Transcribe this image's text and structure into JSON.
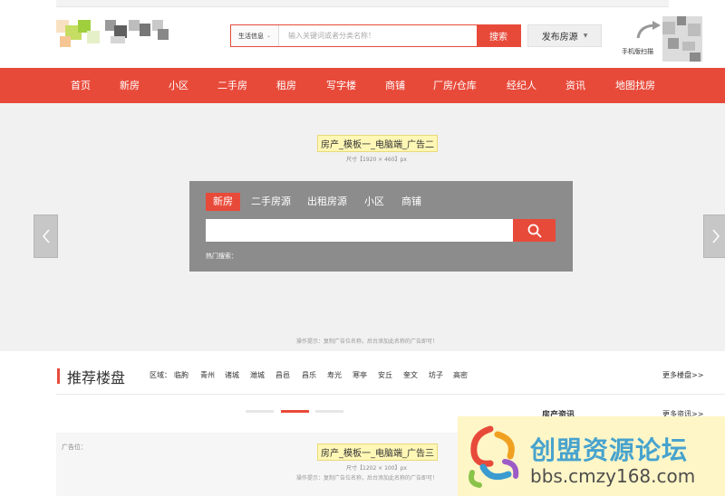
{
  "header": {
    "search": {
      "category": "生活信息",
      "placeholder": "输入关键词或者分类名称！",
      "button": "搜索"
    },
    "publish_button": "发布房源",
    "mobile_text": "手机版扫描"
  },
  "nav": {
    "items": [
      "首页",
      "新房",
      "小区",
      "二手房",
      "租房",
      "写字楼",
      "商铺",
      "厂房/仓库",
      "经纪人",
      "资讯",
      "地图找房"
    ]
  },
  "banner": {
    "ad_label": "房产_模板一_电脑端_广告二",
    "ad_size": "尺寸【1920 × 460】px",
    "tabs": [
      "新房",
      "二手房源",
      "出租房源",
      "小区",
      "商铺"
    ],
    "hot_label": "热门搜索：",
    "tip": "操作提示：复制广告位名称，后台添加此名称的广告即可！"
  },
  "recommend": {
    "title": "推荐楼盘",
    "region_label": "区域：",
    "regions": [
      "临朐",
      "青州",
      "诸城",
      "潍城",
      "昌邑",
      "昌乐",
      "寿光",
      "寒亭",
      "安丘",
      "奎文",
      "坊子",
      "高密"
    ],
    "more": "更多楼盘>>"
  },
  "news": {
    "title": "房产资讯",
    "more": "更多资讯>>"
  },
  "ad_three": {
    "label": "广告位：",
    "ad_label": "房产_模板一_电脑端_广告三",
    "ad_size": "尺寸【1202 × 100】px",
    "tip": "操作提示：复制广告位名称，后台添加此名称的广告即可！"
  },
  "watermark": {
    "brand": "创盟资源论坛",
    "url": "bbs.cmzy168.com"
  },
  "colors": {
    "accent": "#e84a3a",
    "banner_bg": "#f1f1f1",
    "search_box": "#8c8c8c"
  }
}
